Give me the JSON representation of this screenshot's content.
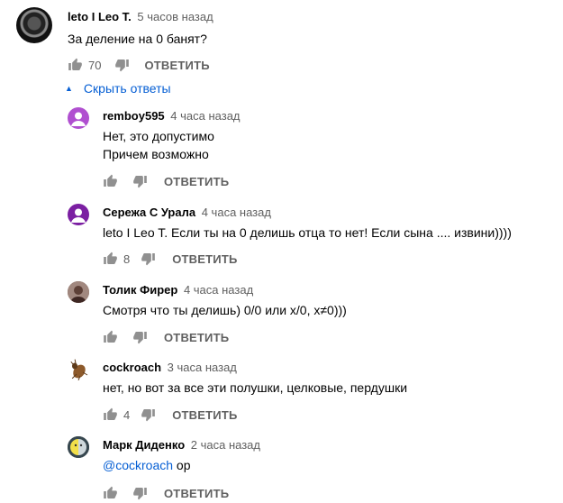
{
  "top_comment": {
    "author": "leto I Leo T.",
    "time": "5 часов назад",
    "text": "За деление на 0 банят?",
    "likes": "70",
    "reply_label": "ОТВЕТИТЬ"
  },
  "hide_replies_label": "Скрыть ответы",
  "replies": [
    {
      "author": "remboy595",
      "time": "4 часа назад",
      "lines": [
        "Нет, это допустимо",
        "Причем возможно"
      ],
      "likes": "",
      "reply_label": "ОТВЕТИТЬ",
      "avatar_color": "#b04fd0"
    },
    {
      "author": "Сережа С Урала",
      "time": "4 часа назад",
      "lines": [
        "leto I Leo T. Если ты на 0 делишь отца то нет! Если сына .... извини))))"
      ],
      "likes": "8",
      "reply_label": "ОТВЕТИТЬ",
      "avatar_color": "#7b1fa2"
    },
    {
      "author": "Толик Фирер",
      "time": "4 часа назад",
      "lines": [
        "Смотря что ты делишь) 0/0 или x/0, x≠0)))"
      ],
      "likes": "",
      "reply_label": "ОТВЕТИТЬ",
      "avatar_color": "#6d4c41"
    },
    {
      "author": "cockroach",
      "time": "3 часа назад",
      "lines": [
        "нет, но вот за все эти полушки, целковые, пердушки"
      ],
      "likes": "4",
      "reply_label": "ОТВЕТИТЬ",
      "avatar_color": "#8d5a2b"
    },
    {
      "author": "Марк Диденко",
      "time": "2 часа назад",
      "mention": "@cockroach",
      "text_after": " ор",
      "likes": "",
      "reply_label": "ОТВЕТИТЬ",
      "avatar_color": "#e8d34a"
    }
  ]
}
